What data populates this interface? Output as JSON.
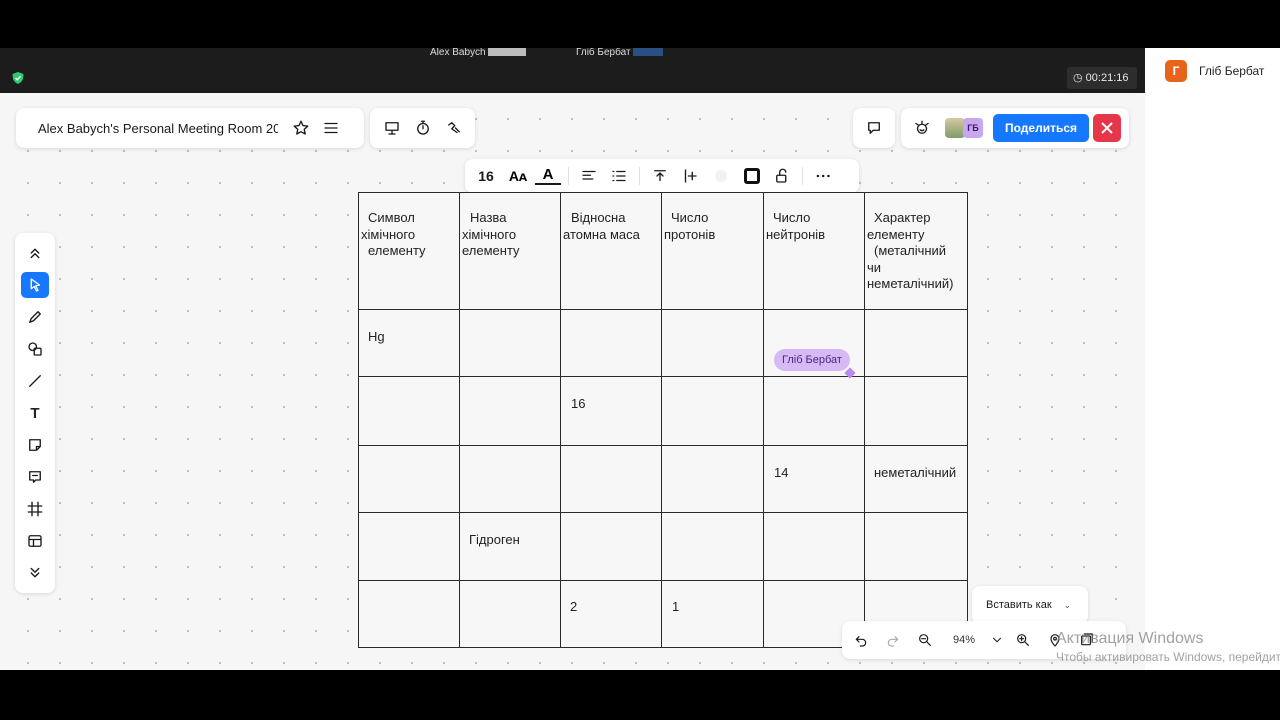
{
  "video_strip": {
    "thumb1_name": "Alex Babych",
    "thumb2_name": "Гліб Бербат",
    "timer": "00:21:16"
  },
  "right_panel": {
    "avatar_letter": "Г",
    "name": "Гліб Бербат"
  },
  "header": {
    "title": "Alex Babych's Personal Meeting Room 20...",
    "avatar_initials": "ГБ",
    "share_label": "Поделиться"
  },
  "format_toolbar": {
    "font_size": "16",
    "font_size_glyph": "Aᴀ",
    "text_color_glyph": "A"
  },
  "table": {
    "headers": [
      [
        "Символ",
        "хімічного",
        "елементу"
      ],
      [
        "Назва",
        "хімічного",
        "елементу"
      ],
      [
        "Відносна",
        "атомна маса"
      ],
      [
        "Число",
        "протонів"
      ],
      [
        "Число",
        "нейтронів"
      ],
      [
        "Характер",
        "елементу",
        "(металічний",
        "чи",
        "неметалічний)"
      ]
    ],
    "rows": [
      [
        "Hg",
        "",
        "",
        "",
        "",
        ""
      ],
      [
        "",
        "",
        "16",
        "",
        "",
        ""
      ],
      [
        "",
        "",
        "",
        "",
        "14",
        "неметалічний"
      ],
      [
        "",
        "Гідроген",
        "",
        "",
        "",
        ""
      ],
      [
        "",
        "",
        "2",
        "1",
        "",
        ""
      ]
    ]
  },
  "cursor_label": "Гліб Бербат",
  "insert_panel": {
    "label": "Вставить как"
  },
  "bottom_toolbar": {
    "zoom": "94%"
  },
  "watermark": {
    "line1": "Активация Windows",
    "line2": "Чтобы активировать Windows, перейдите"
  },
  "colors": {
    "accent": "#1677ff",
    "close": "#e5364b",
    "cursor_tag": "#d7b9f6",
    "avatar": "#e8641b"
  },
  "icons": [
    "shield-icon",
    "clock-icon",
    "star-icon",
    "menu-icon",
    "presentation-icon",
    "stopwatch-icon",
    "vote-icon",
    "chat-icon",
    "reactions-icon",
    "close-icon",
    "align-left-icon",
    "list-icon",
    "align-middle-icon",
    "add-column-icon",
    "unlock-icon",
    "more-icon",
    "collapse-up-icon",
    "select-icon",
    "pen-icon",
    "shapes-icon",
    "line-icon",
    "text-icon",
    "sticky-note-icon",
    "comment-icon",
    "frame-icon",
    "template-icon",
    "expand-down-icon",
    "undo-icon",
    "redo-icon",
    "zoom-out-icon",
    "zoom-in-icon",
    "location-icon",
    "pages-icon"
  ]
}
